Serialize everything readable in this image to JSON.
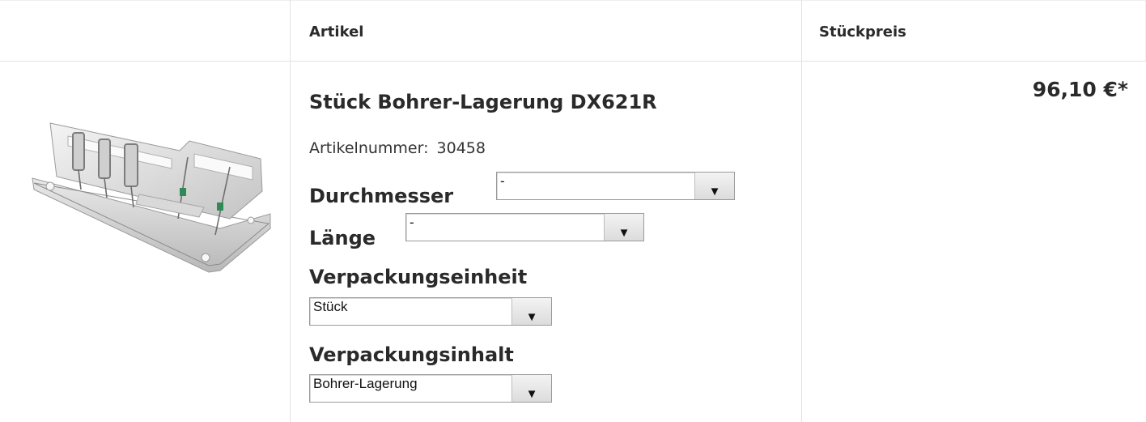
{
  "table": {
    "headers": {
      "article": "Artikel",
      "unit_price": "Stückpreis"
    }
  },
  "product": {
    "image_alt": "Bohrer-Lagerung",
    "title": "Stück Bohrer-Lagerung DX621R",
    "article_number_label": "Artikelnummer:",
    "article_number": "30458",
    "price": "96,10 €*",
    "options": {
      "durchmesser": {
        "label": "Durchmesser",
        "value": "-"
      },
      "laenge": {
        "label": "Länge",
        "value": "-"
      },
      "verpackungseinheit": {
        "label": "Verpackungseinheit",
        "value": "Stück"
      },
      "verpackungsinhalt": {
        "label": "Verpackungsinhalt",
        "value": "Bohrer-Lagerung"
      }
    }
  }
}
